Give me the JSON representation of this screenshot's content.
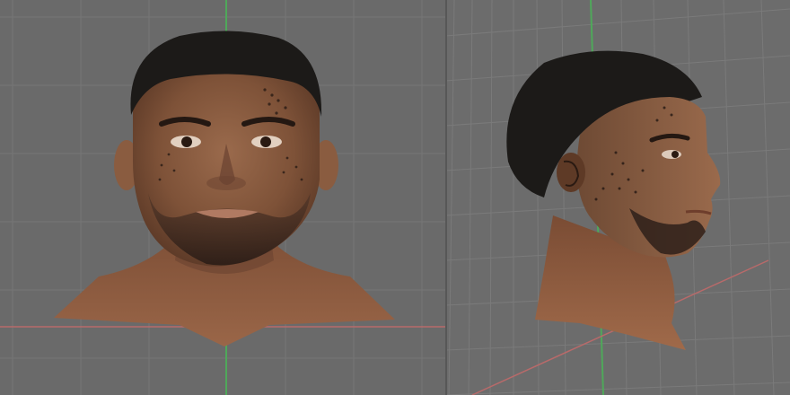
{
  "app": {
    "description_hidden": ""
  },
  "viewports": [
    {
      "id": "front",
      "view_kind": "front-orthographic",
      "show_grid": true,
      "axis_colors": {
        "vertical_axis": "#4fa85a",
        "horizontal_axis": "#b86a6a"
      }
    },
    {
      "id": "side",
      "view_kind": "side-perspective",
      "show_grid": true,
      "axis_colors": {
        "vertical_axis": "#4fa85a",
        "horizontal_axis": "#b86a6a"
      }
    }
  ],
  "colors": {
    "background": "#6a6a6a",
    "grid_line": "#777777",
    "skin": "#8a5a3e",
    "skin_dark": "#5e3a26",
    "skin_light": "#b88a6c",
    "hair": "#1c1a18",
    "beard": "#3a2a22"
  }
}
